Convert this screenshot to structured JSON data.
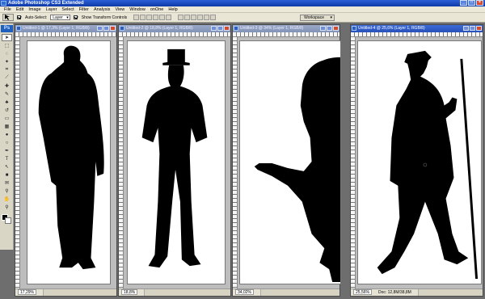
{
  "app": {
    "title": "Adobe Photoshop CS3 Extended"
  },
  "menu": [
    "File",
    "Edit",
    "Image",
    "Layer",
    "Select",
    "Filter",
    "Analysis",
    "View",
    "Window",
    "onOne",
    "Help"
  ],
  "options": {
    "auto_select_label": "Auto-Select:",
    "auto_select_value": "Layer",
    "transform_label": "Show Transform Controls",
    "workspace_label": "Workspace"
  },
  "toolbox": {
    "logo": "Ps"
  },
  "documents": [
    {
      "title": "Untitled-1 @ 17,3% (Layer 1, RGB/8)",
      "zoom": "17,29%",
      "active": false
    },
    {
      "title": "Untitled-2 @ 18,8% (Layer 1, RGB/8)",
      "zoom": "18,8%",
      "active": false
    },
    {
      "title": "Untitled-3 @ 34% (Layer 1, RGB/8)",
      "zoom": "34,02%",
      "active": false
    },
    {
      "title": "Untitled-4 @ 25,6% (Layer 1, RGB/8)",
      "zoom": "25,56%",
      "active": true,
      "doc_info": "Doc: 12,8M/38,8M"
    }
  ],
  "colors": {
    "title_active": "#2850b8",
    "title_inactive": "#8193b6",
    "workspace_bg": "#6e6e6e",
    "foreground": "#000000",
    "background": "#ffffff"
  },
  "icons": [
    "move-icon",
    "marquee-icon",
    "lasso-icon",
    "magic-wand-icon",
    "crop-icon",
    "slice-icon",
    "healing-icon",
    "brush-icon",
    "clone-stamp-icon",
    "history-brush-icon",
    "eraser-icon",
    "gradient-icon",
    "blur-icon",
    "dodge-icon",
    "pen-icon",
    "type-icon",
    "path-select-icon",
    "shape-icon",
    "notes-icon",
    "eyedropper-icon",
    "hand-icon",
    "zoom-icon"
  ]
}
